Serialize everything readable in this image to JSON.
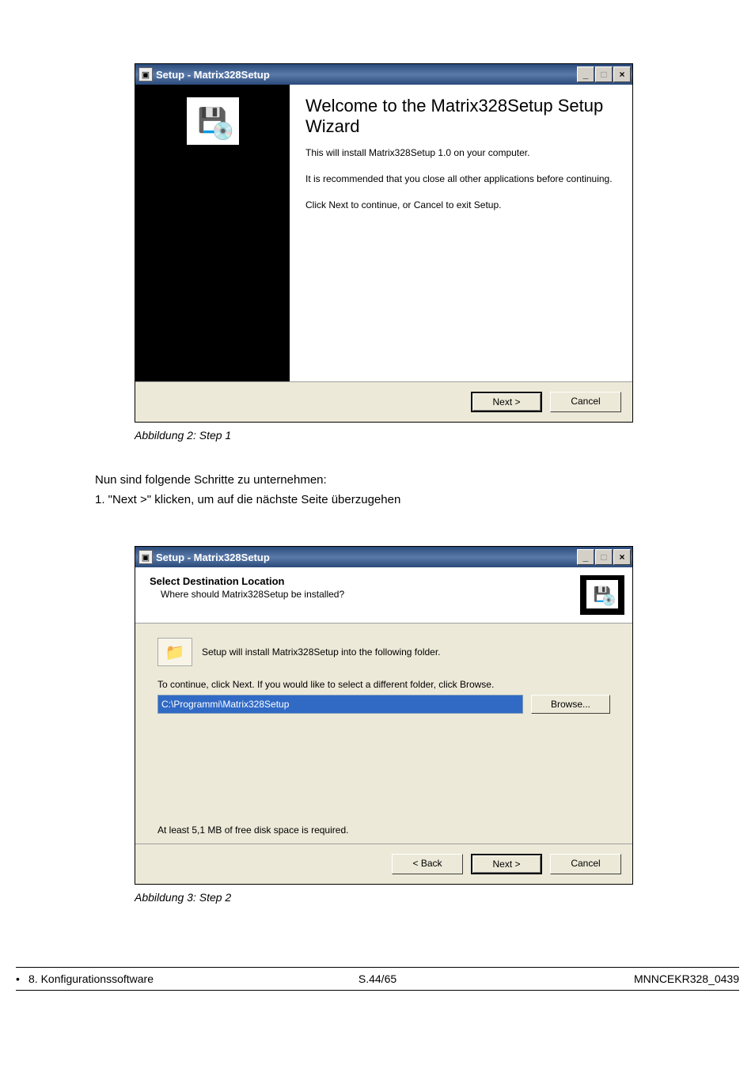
{
  "wizard1": {
    "window_title": "Setup - Matrix328Setup",
    "heading": "Welcome to the Matrix328Setup Setup Wizard",
    "p1": "This will install Matrix328Setup 1.0 on your computer.",
    "p2": "It is recommended that you close all other applications before continuing.",
    "p3": "Click Next to continue, or Cancel to exit Setup.",
    "next": "Next >",
    "cancel": "Cancel"
  },
  "caption1": "Abbildung 2: Step 1",
  "para1": "Nun sind folgende Schritte zu unternehmen:",
  "step1": "1.  \"Next >\" klicken, um auf die nächste Seite überzugehen",
  "wizard2": {
    "window_title": "Setup - Matrix328Setup",
    "title": "Select Destination Location",
    "subtitle": "Where should Matrix328Setup be installed?",
    "line1": "Setup will install Matrix328Setup into the following folder.",
    "line2": "To continue, click Next. If you would like to select a different folder, click Browse.",
    "path": "C:\\Programmi\\Matrix328Setup",
    "browse": "Browse...",
    "disk": "At least 5,1 MB of free disk space is required.",
    "back": "< Back",
    "next": "Next >",
    "cancel": "Cancel"
  },
  "caption2": "Abbildung 3: Step 2",
  "footer": {
    "left": "8. Konfigurationssoftware",
    "center": "S.44/65",
    "right": "MNNCEKR328_0439"
  },
  "glyph": {
    "minimize": "_",
    "maximize": "□",
    "close": "×",
    "install": "💾",
    "install2": "💿",
    "folder": "📁"
  }
}
